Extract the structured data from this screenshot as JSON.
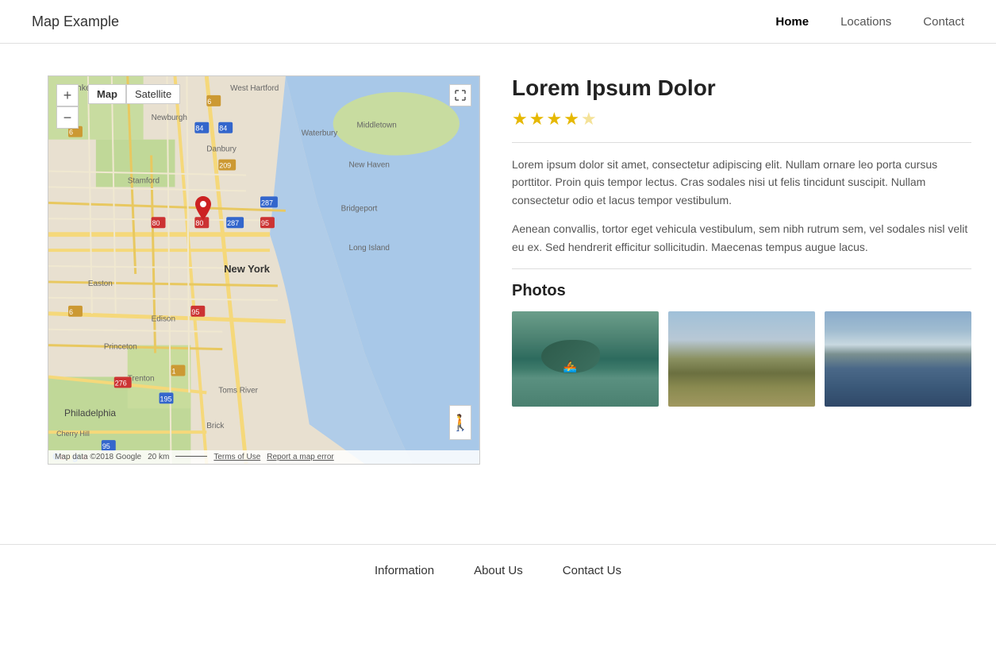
{
  "header": {
    "logo": "Map Example",
    "nav": [
      {
        "label": "Home",
        "active": true
      },
      {
        "label": "Locations",
        "active": false
      },
      {
        "label": "Contact",
        "active": false
      }
    ]
  },
  "map": {
    "zoom_in_label": "+",
    "zoom_out_label": "−",
    "type_buttons": [
      "Map",
      "Satellite"
    ],
    "footer_text": "Map data ©2018 Google",
    "scale_text": "20 km",
    "terms_text": "Terms of Use",
    "report_text": "Report a map error"
  },
  "place": {
    "title": "Lorem Ipsum Dolor",
    "rating": 4,
    "max_rating": 5,
    "description_1": "Lorem ipsum dolor sit amet, consectetur adipiscing elit. Nullam ornare leo porta cursus porttitor. Proin quis tempor lectus. Cras sodales nisi ut felis tincidunt suscipit. Nullam consectetur odio et lacus tempor vestibulum.",
    "description_2": "Aenean convallis, tortor eget vehicula vestibulum, sem nibh rutrum sem, vel sodales nisl velit eu ex. Sed hendrerit efficitur sollicitudin. Maecenas tempus augue lacus.",
    "photos_title": "Photos"
  },
  "footer": {
    "links": [
      {
        "label": "Information"
      },
      {
        "label": "About Us"
      },
      {
        "label": "Contact Us"
      }
    ]
  }
}
